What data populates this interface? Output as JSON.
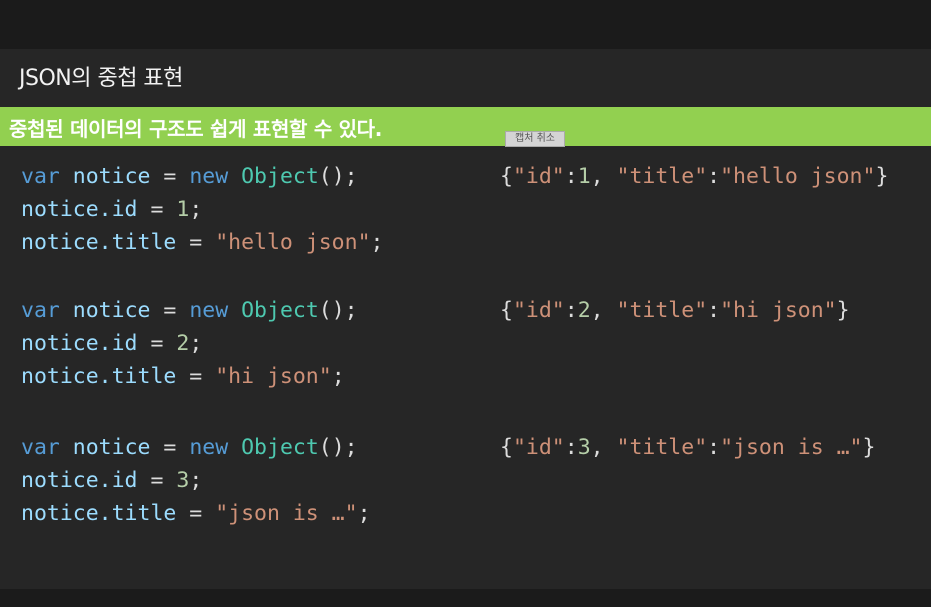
{
  "slide": {
    "title": "JSON의 중첩 표현",
    "banner": "중첩된 데이터의 구조도 쉽게 표현할 수 있다.",
    "capture_button": "캡처 취소"
  },
  "code_blocks": [
    {
      "id_value": "1",
      "title_value": "\"hello json\"",
      "json_id": "1",
      "json_title": "\"hello json\""
    },
    {
      "id_value": "2",
      "title_value": "\"hi json\"",
      "json_id": "2",
      "json_title": "\"hi json\""
    },
    {
      "id_value": "3",
      "title_value": "\"json is …\"",
      "json_id": "3",
      "json_title": "\"json is …\""
    }
  ],
  "tokens": {
    "var": "var",
    "notice": "notice",
    "new": "new",
    "object": "Object",
    "paren": "();",
    "eq": " = ",
    "semi": ";",
    "dot_id": ".id",
    "dot_title": ".title",
    "json_open": "{",
    "json_id_key": "\"id\"",
    "json_colon": ":",
    "json_comma": ", ",
    "json_title_key": "\"title\"",
    "json_close": "}"
  },
  "colors": {
    "keyword": "#569cd6",
    "identifier": "#9cdcfe",
    "class": "#4ec9b0",
    "number": "#b5cea8",
    "string": "#ce9178",
    "banner": "#92d050"
  }
}
